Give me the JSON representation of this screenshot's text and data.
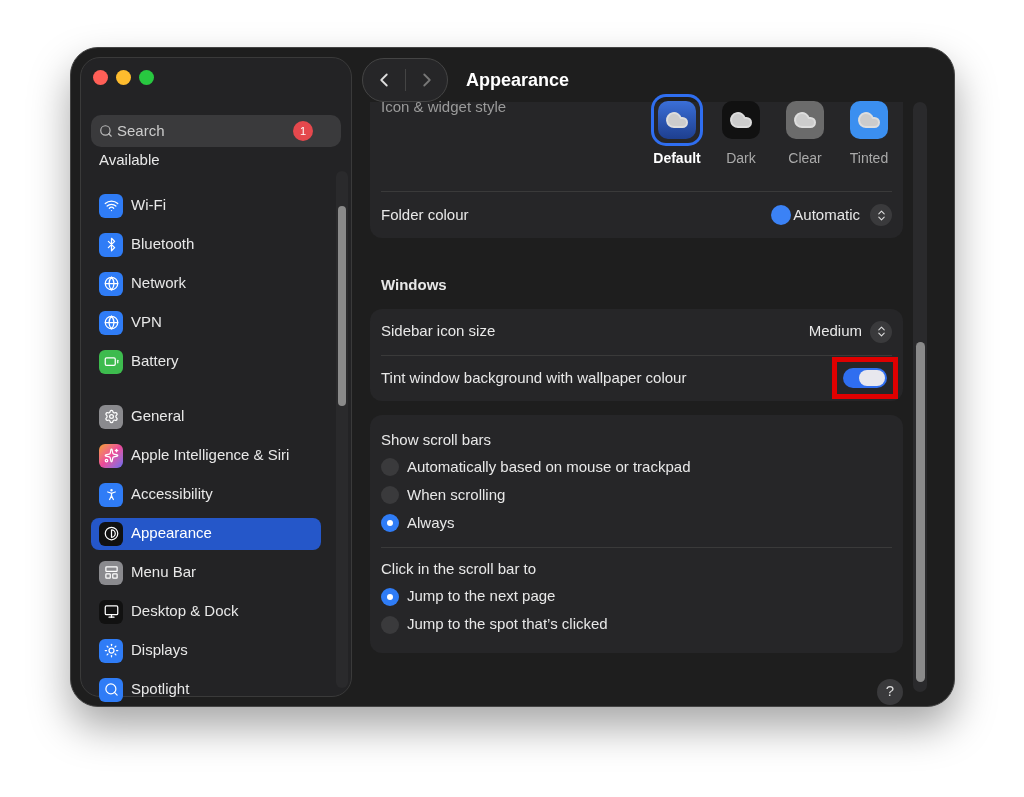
{
  "header": {
    "title": "Appearance"
  },
  "sidebar": {
    "search": {
      "placeholder": "Search"
    },
    "update": {
      "label": "Available",
      "badge": "1"
    },
    "groups": [
      [
        {
          "label": "Wi-Fi",
          "kind": "wifi",
          "selected": false
        },
        {
          "label": "Bluetooth",
          "kind": "bluetooth",
          "selected": false
        },
        {
          "label": "Network",
          "kind": "network",
          "selected": false
        },
        {
          "label": "VPN",
          "kind": "vpn",
          "selected": false
        },
        {
          "label": "Battery",
          "kind": "battery",
          "selected": false
        }
      ],
      [
        {
          "label": "General",
          "kind": "general",
          "selected": false
        },
        {
          "label": "Apple Intelligence & Siri",
          "kind": "siri",
          "selected": false
        },
        {
          "label": "Accessibility",
          "kind": "accessibility",
          "selected": false
        },
        {
          "label": "Appearance",
          "kind": "appearance",
          "selected": true
        },
        {
          "label": "Menu Bar",
          "kind": "menubar",
          "selected": false
        },
        {
          "label": "Desktop & Dock",
          "kind": "dock",
          "selected": false
        },
        {
          "label": "Displays",
          "kind": "displays",
          "selected": false
        },
        {
          "label": "Spotlight",
          "kind": "spotlight",
          "selected": false
        }
      ]
    ]
  },
  "icon_style": {
    "label": "Icon & widget style",
    "options": [
      {
        "label": "Default",
        "kind": "default",
        "selected": true
      },
      {
        "label": "Dark",
        "kind": "dark",
        "selected": false
      },
      {
        "label": "Clear",
        "kind": "clear",
        "selected": false
      },
      {
        "label": "Tinted",
        "kind": "tinted",
        "selected": false
      }
    ]
  },
  "folder_colour": {
    "label": "Folder colour",
    "value": "Automatic"
  },
  "windows": {
    "heading": "Windows",
    "rows": [
      {
        "kind": "select",
        "label": "Sidebar icon size",
        "value": "Medium"
      },
      {
        "kind": "toggle",
        "label": "Tint window background with wallpaper colour",
        "on": true,
        "highlighted": true
      }
    ]
  },
  "scroll": {
    "groups": [
      {
        "label": "Show scroll bars",
        "options": [
          {
            "label": "Automatically based on mouse or trackpad",
            "selected": false
          },
          {
            "label": "When scrolling",
            "selected": false
          },
          {
            "label": "Always",
            "selected": true
          }
        ]
      },
      {
        "label": "Click in the scroll bar to",
        "options": [
          {
            "label": "Jump to the next page",
            "selected": true
          },
          {
            "label": "Jump to the spot that’s clicked",
            "selected": false
          }
        ]
      }
    ]
  },
  "help": {
    "label": "?"
  }
}
